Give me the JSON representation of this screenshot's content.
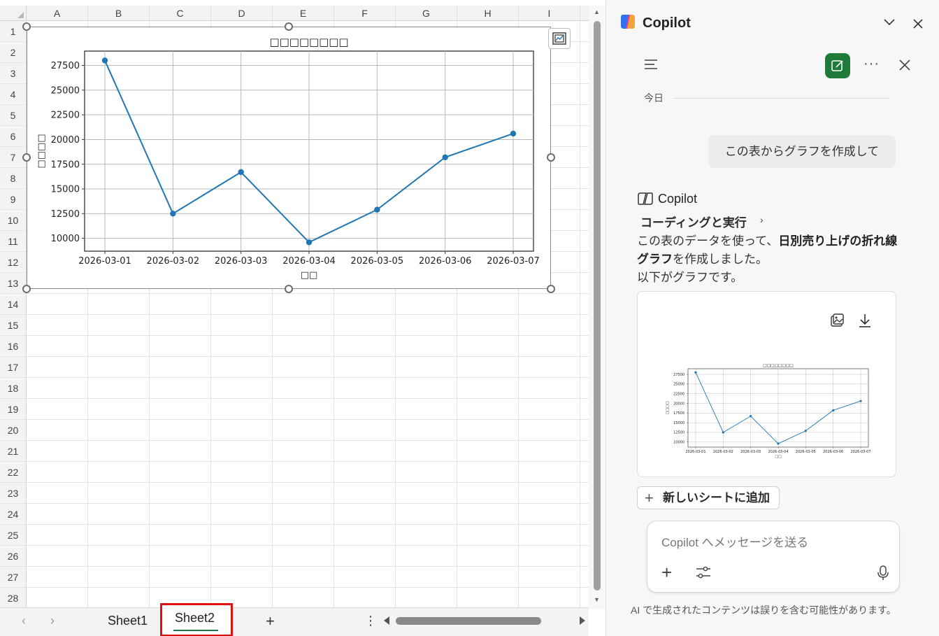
{
  "sheet": {
    "columns": [
      "A",
      "B",
      "C",
      "D",
      "E",
      "F",
      "G",
      "H",
      "I"
    ],
    "rows": [
      "1",
      "2",
      "3",
      "4",
      "5",
      "6",
      "7",
      "8",
      "9",
      "10",
      "11",
      "12",
      "13",
      "14",
      "15",
      "16",
      "17",
      "18",
      "19",
      "20",
      "21",
      "22",
      "23",
      "24",
      "25",
      "26",
      "27",
      "28"
    ],
    "tabs": {
      "prev": "‹",
      "next": "›",
      "sheet1": "Sheet1",
      "sheet2": "Sheet2",
      "add": "+",
      "more": "⋮"
    }
  },
  "chart_data": {
    "type": "line",
    "title": "□□□□□□□□",
    "xlabel": "□□",
    "ylabel": "□□□□",
    "categories": [
      "2026-03-01",
      "2026-03-02",
      "2026-03-03",
      "2026-03-04",
      "2026-03-05",
      "2026-03-06",
      "2026-03-07"
    ],
    "values": [
      28000,
      12500,
      16700,
      9600,
      12900,
      18200,
      20600
    ],
    "yticks": [
      "10000",
      "12500",
      "15000",
      "17500",
      "20000",
      "22500",
      "25000",
      "27500"
    ],
    "ylim": [
      8700,
      28950
    ],
    "grid": true,
    "color": "#1f77b4"
  },
  "copilot": {
    "title": "Copilot",
    "today": "今日",
    "user_message": "この表からグラフを作成して",
    "responder": "Copilot",
    "coding_link": "コーディングと実行",
    "coding_chevron": "›",
    "resp_part1": "この表のデータを使って、",
    "resp_bold1": "日別売り上げの折れ線グラフ",
    "resp_part2": "を作成しました。",
    "resp_line2": "以下がグラフです。",
    "add_to_sheet": "新しいシートに追加",
    "add_plus": "+",
    "input_placeholder": "Copilot へメッセージを送る",
    "input_plus": "+",
    "more": "···",
    "disclaimer": "AI で生成されたコンテンツは誤りを含む可能性があります。",
    "accent_color": "#1e7b3a"
  }
}
